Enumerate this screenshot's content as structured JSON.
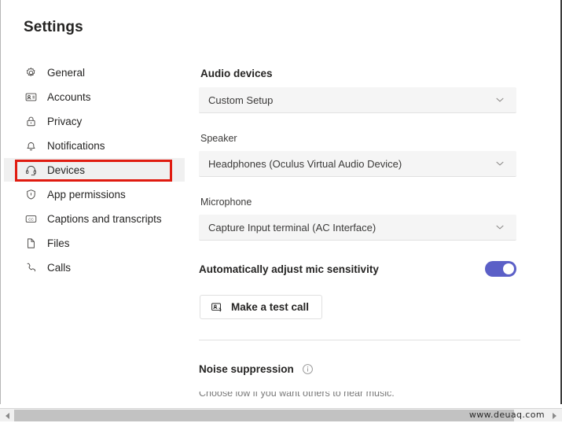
{
  "window": {
    "title": "Settings"
  },
  "sidebar": {
    "items": [
      {
        "label": "General",
        "icon": "gear-icon"
      },
      {
        "label": "Accounts",
        "icon": "id-card-icon"
      },
      {
        "label": "Privacy",
        "icon": "lock-icon"
      },
      {
        "label": "Notifications",
        "icon": "bell-icon"
      },
      {
        "label": "Devices",
        "icon": "headset-icon"
      },
      {
        "label": "App permissions",
        "icon": "shield-icon"
      },
      {
        "label": "Captions and transcripts",
        "icon": "closed-caption-icon"
      },
      {
        "label": "Files",
        "icon": "file-icon"
      },
      {
        "label": "Calls",
        "icon": "phone-icon"
      }
    ],
    "selected_index": 4,
    "annotation_color": "#e01b10"
  },
  "main": {
    "audio_devices": {
      "heading": "Audio devices",
      "value": "Custom Setup",
      "chevron": "chevron-down-icon"
    },
    "speaker": {
      "label": "Speaker",
      "value": "Headphones (Oculus Virtual Audio Device)",
      "chevron": "chevron-down-icon"
    },
    "microphone": {
      "label": "Microphone",
      "value": "Capture Input terminal (AC Interface)",
      "chevron": "chevron-down-icon"
    },
    "auto_mic": {
      "label": "Automatically adjust mic sensitivity",
      "state": "on",
      "accent_color": "#5b5fc7"
    },
    "test_call": {
      "label": "Make a test call",
      "icon": "person-call-icon"
    },
    "noise_suppression": {
      "label": "Noise suppression",
      "icon": "info-icon",
      "description_clipped": "Choose low if you want others to hear music."
    }
  },
  "scrollbar": {
    "left_arrow": "triangle-left-icon",
    "right_arrow": "triangle-right-icon"
  },
  "watermark": {
    "text": "www.deuaq.com"
  }
}
